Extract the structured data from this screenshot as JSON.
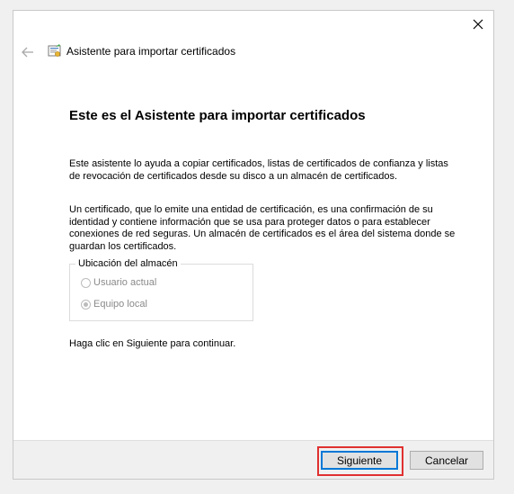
{
  "window": {
    "title": "Asistente para importar certificados"
  },
  "content": {
    "heading": "Este es el Asistente para importar certificados",
    "paragraph1": "Este asistente lo ayuda a copiar certificados, listas de certificados de confianza y listas de revocación de certificados desde su disco a un almacén de certificados.",
    "paragraph2": "Un certificado, que lo emite una entidad de certificación, es una confirmación de su identidad y contiene información que se usa para proteger datos o para establecer conexiones de red seguras. Un almacén de certificados es el área del sistema donde se guardan los certificados.",
    "store_location": {
      "legend": "Ubicación del almacén",
      "options": [
        {
          "label": "Usuario actual",
          "selected": false,
          "enabled": false
        },
        {
          "label": "Equipo local",
          "selected": true,
          "enabled": false
        }
      ]
    },
    "paragraph3": "Haga clic en Siguiente para continuar."
  },
  "buttons": {
    "next": "Siguiente",
    "cancel": "Cancelar"
  },
  "icons": {
    "close": "close-icon",
    "back": "back-arrow-icon",
    "app": "certificate-icon"
  },
  "colors": {
    "highlight": "#e03030",
    "focus_border": "#0078d7"
  }
}
